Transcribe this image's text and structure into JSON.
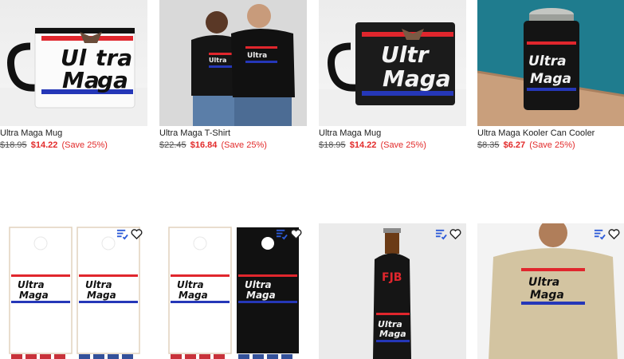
{
  "products": [
    {
      "title": "Ultra Maga Mug",
      "old_price": "$18.95",
      "new_price": "$14.22",
      "save": "(Save 25%)"
    },
    {
      "title": "Ultra Maga T-Shirt",
      "old_price": "$22.45",
      "new_price": "$16.84",
      "save": "(Save 25%)"
    },
    {
      "title": "Ultra Maga Mug",
      "old_price": "$18.95",
      "new_price": "$14.22",
      "save": "(Save 25%)"
    },
    {
      "title": "Ultra Maga Kooler Can Cooler",
      "old_price": "$8.35",
      "new_price": "$6.27",
      "save": "(Save 25%)"
    }
  ],
  "design": {
    "word1": "Ultra",
    "word2": "Maga",
    "monogram": "FJB"
  },
  "icons": {
    "compare": "compare-icon",
    "favorite": "heart-icon"
  },
  "colors": {
    "sale": "#e22b2b",
    "stripe_red": "#e0262d",
    "stripe_blue": "#2537b8",
    "compare_icon": "#2d5bd8"
  }
}
